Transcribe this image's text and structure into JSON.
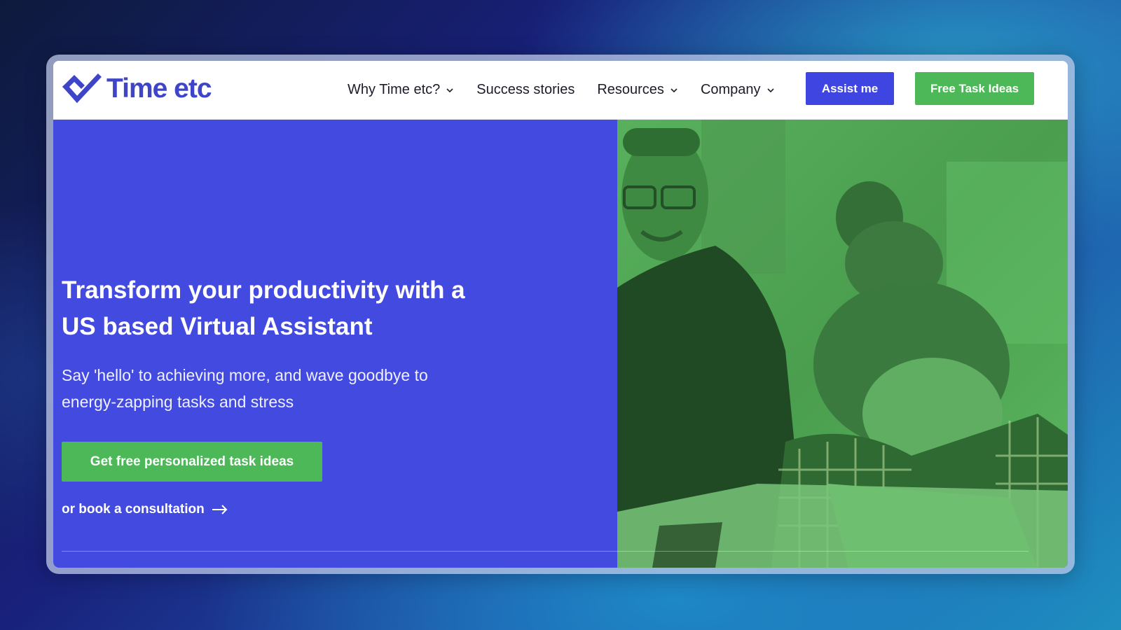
{
  "brand": {
    "name": "Time etc",
    "primary_color": "#434ae0",
    "accent_color": "#4db857",
    "logo_icon": "heart-check-icon"
  },
  "nav": {
    "items": [
      {
        "label": "Why Time etc?",
        "has_dropdown": true
      },
      {
        "label": "Success stories",
        "has_dropdown": false
      },
      {
        "label": "Resources",
        "has_dropdown": true
      },
      {
        "label": "Company",
        "has_dropdown": true
      }
    ],
    "assist_button": "Assist me",
    "free_button": "Free Task Ideas"
  },
  "hero": {
    "title": "Transform your productivity with a US based Virtual Assistant",
    "subtitle": "Say 'hello' to achieving more, and wave goodbye to energy-zapping tasks and stress",
    "cta_label": "Get free personalized task ideas",
    "consult_label": "or book a consultation",
    "photo_tint": "#4a9e4e"
  }
}
